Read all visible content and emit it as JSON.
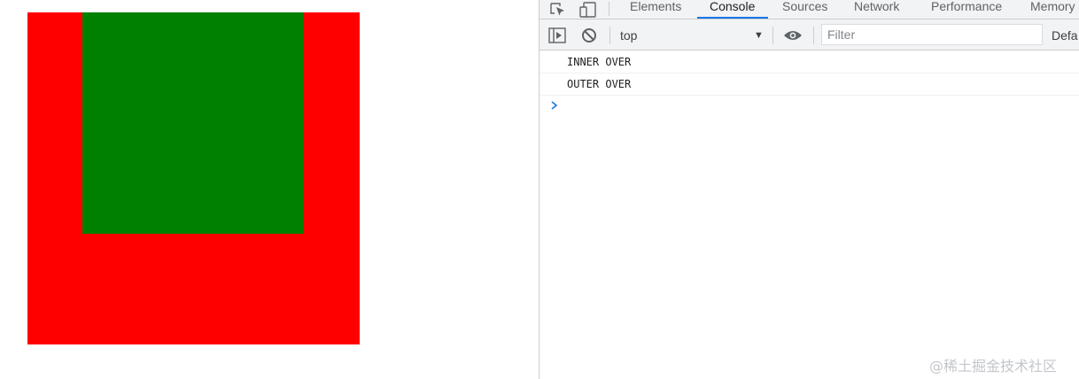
{
  "page": {
    "outer_color": "#ff0000",
    "inner_color": "#008000"
  },
  "devtools": {
    "tabs": [
      {
        "label": "Elements",
        "active": false
      },
      {
        "label": "Console",
        "active": true
      },
      {
        "label": "Sources",
        "active": false
      },
      {
        "label": "Network",
        "active": false
      },
      {
        "label": "Performance",
        "active": false
      },
      {
        "label": "Memory",
        "active": false
      }
    ],
    "tools": {
      "inspect_icon": "inspect-element-icon",
      "device_icon": "device-toolbar-icon"
    },
    "toolbar": {
      "sidebar_icon": "console-sidebar-icon",
      "clear_icon": "clear-console-icon",
      "context": "top",
      "context_arrow": "▼",
      "eye_icon": "live-expression-icon",
      "filter_placeholder": "Filter",
      "levels": "Defa"
    },
    "console": {
      "messages": [
        "INNER OVER",
        "OUTER OVER"
      ],
      "prompt_icon": "prompt-chevron-icon"
    },
    "accent": "#1a73e8"
  },
  "watermark": "@稀土掘金技术社区"
}
